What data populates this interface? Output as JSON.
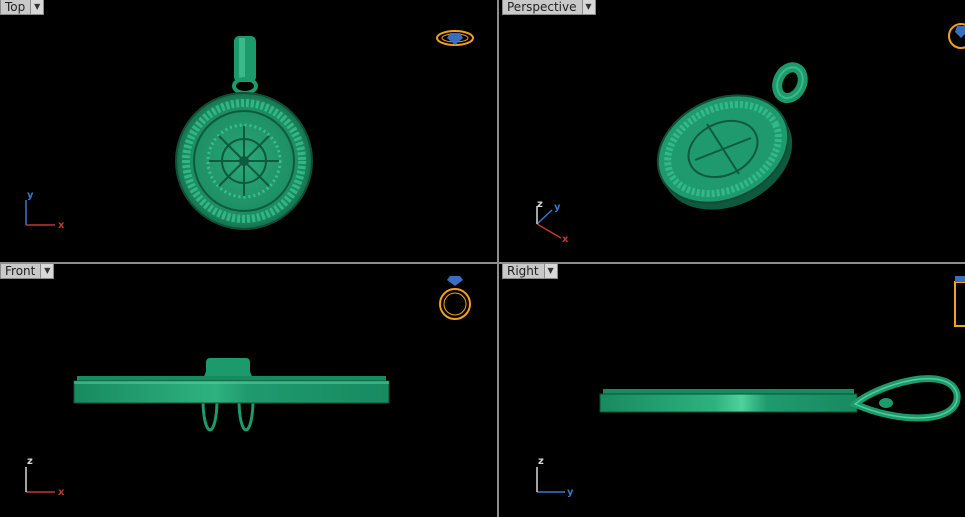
{
  "viewports": {
    "top": {
      "label": "Top",
      "axes": {
        "horizontal": "x",
        "vertical": "y"
      }
    },
    "perspective": {
      "label": "Perspective",
      "axes": {
        "horizontal": "x",
        "vertical": "y",
        "up": "z"
      }
    },
    "front": {
      "label": "Front",
      "axes": {
        "horizontal": "x",
        "vertical": "z"
      }
    },
    "right": {
      "label": "Right",
      "axes": {
        "horizontal": "y",
        "vertical": "z"
      }
    }
  },
  "icons": {
    "menu": "triangle-down-icon",
    "view_gizmo": "ring-gizmo-icon"
  },
  "colors": {
    "model": "#1f9a6e",
    "model_highlight": "#6fe0b0",
    "background": "#000000",
    "tab": "#c9c9c9",
    "axis_x": "#c0392b",
    "axis_y": "#3a78c8",
    "axis_z": "#d8d8d8",
    "gizmo": "#f2a21b"
  }
}
